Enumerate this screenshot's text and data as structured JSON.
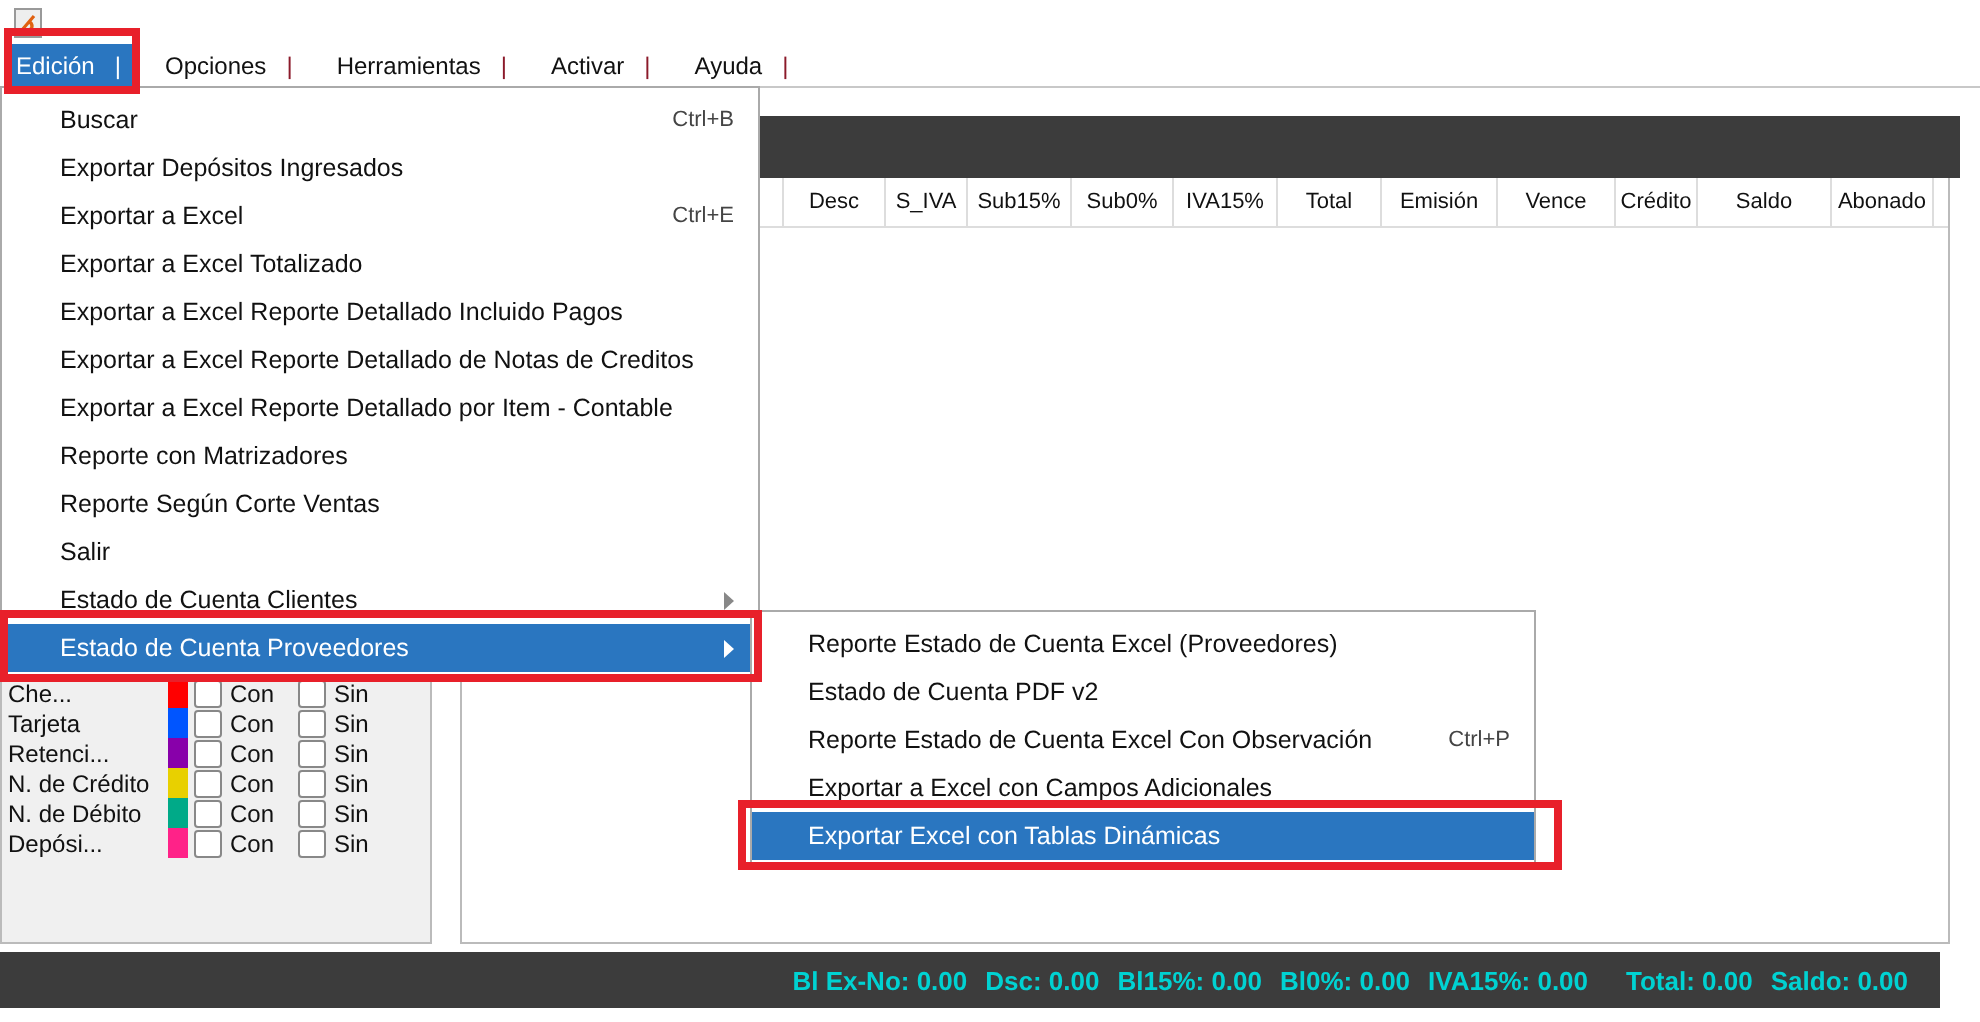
{
  "menubar": [
    {
      "label": "Edición",
      "separator": "|",
      "selected": true,
      "highlighted": true
    },
    {
      "label": "Opciones",
      "separator": "|",
      "selected": false,
      "highlighted": false
    },
    {
      "label": "Herramientas",
      "separator": "|",
      "selected": false,
      "highlighted": false
    },
    {
      "label": "Activar",
      "separator": "|",
      "selected": false,
      "highlighted": false
    },
    {
      "label": "Ayuda",
      "separator": "|",
      "selected": false,
      "highlighted": false
    }
  ],
  "menu": [
    {
      "label": "Buscar",
      "shortcut": "Ctrl+B",
      "kind": "item",
      "selected": false,
      "highlighted": false
    },
    {
      "label": "Exportar Depósitos Ingresados",
      "kind": "item",
      "selected": false,
      "highlighted": false
    },
    {
      "label": "Exportar a Excel",
      "shortcut": "Ctrl+E",
      "kind": "item",
      "selected": false,
      "highlighted": false
    },
    {
      "label": "Exportar a Excel Totalizado",
      "kind": "item",
      "selected": false,
      "highlighted": false
    },
    {
      "label": "Exportar a Excel Reporte Detallado Incluido Pagos",
      "kind": "item",
      "selected": false,
      "highlighted": false
    },
    {
      "label": "Exportar a Excel Reporte Detallado de Notas de Creditos",
      "kind": "item",
      "selected": false,
      "highlighted": false
    },
    {
      "label": "Exportar a Excel Reporte Detallado por Item - Contable",
      "kind": "item",
      "selected": false,
      "highlighted": false
    },
    {
      "label": "Reporte con Matrizadores",
      "kind": "item",
      "selected": false,
      "highlighted": false
    },
    {
      "label": "Reporte Según Corte Ventas",
      "kind": "item",
      "selected": false,
      "highlighted": false
    },
    {
      "label": "Salir",
      "kind": "item",
      "selected": false,
      "highlighted": false
    },
    {
      "label": "Estado de Cuenta Clientes",
      "kind": "submenu",
      "selected": false,
      "highlighted": false
    },
    {
      "label": "Estado de Cuenta Proveedores",
      "kind": "submenu",
      "selected": true,
      "highlighted": true
    }
  ],
  "submenu": [
    {
      "label": "Reporte Estado de Cuenta Excel (Proveedores)",
      "selected": false,
      "highlighted": false
    },
    {
      "label": "Estado de Cuenta PDF v2",
      "selected": false,
      "highlighted": false
    },
    {
      "label": "Reporte Estado de Cuenta Excel Con Observación",
      "shortcut": "Ctrl+P",
      "selected": false,
      "highlighted": false
    },
    {
      "label": "Exportar a Excel con Campos Adicionales",
      "selected": false,
      "highlighted": false
    },
    {
      "label": "Exportar Excel con Tablas Dinámicas",
      "selected": true,
      "highlighted": true
    }
  ],
  "table": {
    "columns": [
      "Desc",
      "S_IVA",
      "Sub15%",
      "Sub0%",
      "IVA15%",
      "Total",
      "Emisión",
      "Vence",
      "Crédito",
      "Saldo",
      "Abonado"
    ]
  },
  "legend": [
    {
      "label": "Che...",
      "color": "#ff0000",
      "con": "Con",
      "sin": "Sin",
      "con_checked": false,
      "sin_checked": false
    },
    {
      "label": "Tarjeta",
      "color": "#0055ff",
      "con": "Con",
      "sin": "Sin",
      "con_checked": false,
      "sin_checked": false
    },
    {
      "label": "Retenci...",
      "color": "#8800aa",
      "con": "Con",
      "sin": "Sin",
      "con_checked": false,
      "sin_checked": false
    },
    {
      "label": "N. de Crédito",
      "color": "#e8d000",
      "con": "Con",
      "sin": "Sin",
      "con_checked": false,
      "sin_checked": false
    },
    {
      "label": "N. de Débito",
      "color": "#00aa88",
      "con": "Con",
      "sin": "Sin",
      "con_checked": false,
      "sin_checked": false
    },
    {
      "label": "Depósi...",
      "color": "#ff2288",
      "con": "Con",
      "sin": "Sin",
      "con_checked": false,
      "sin_checked": false
    }
  ],
  "totals": [
    "Bl Ex-No: 0.00",
    "Dsc: 0.00",
    "Bl15%: 0.00",
    "Bl0%: 0.00",
    "IVA15%: 0.00",
    "Total: 0.00",
    "Saldo: 0.00"
  ]
}
